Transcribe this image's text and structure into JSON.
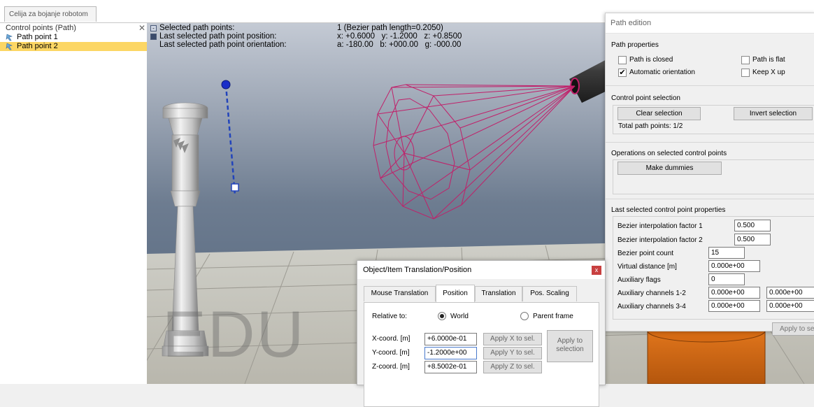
{
  "tab": {
    "label": "Celija za bojanje robotom"
  },
  "hierarchy": {
    "title": "Control points (Path)",
    "close": "✕",
    "items": [
      {
        "label": "Path point 1",
        "selected": false
      },
      {
        "label": "Path point 2",
        "selected": true
      }
    ]
  },
  "info": {
    "minimize_glyph": "-",
    "rows": [
      {
        "label": "Selected path points:",
        "value": "1 (Bezier path length=0.2050)"
      },
      {
        "label": "Last selected path point position:",
        "value": "x: +0.6000   y: -1.2000   z: +0.8500"
      },
      {
        "label": "Last selected path point orientation:",
        "value": "a: -180.00   b: +000.00   g: -000.00"
      }
    ]
  },
  "watermark": "EDU",
  "path_edition": {
    "title": "Path edition",
    "path_properties": "Path properties",
    "path_is_closed": "Path is closed",
    "path_is_flat": "Path is flat",
    "automatic_orientation": "Automatic orientation",
    "keep_x_up": "Keep X up",
    "check_mark": "✔",
    "checks": {
      "path_is_closed": false,
      "path_is_flat": false,
      "automatic_orientation": true,
      "keep_x_up": false
    },
    "control_point_selection": "Control point selection",
    "clear_selection": "Clear selection",
    "invert_selection": "Invert selection",
    "total_path_points": "Total path points: 1/2",
    "operations": "Operations on selected control points",
    "make_dummies": "Make dummies",
    "last_selected_props": "Last selected control point properties",
    "bezier_factor_1_label": "Bezier interpolation factor 1",
    "bezier_factor_1": "0.500",
    "bezier_factor_2_label": "Bezier interpolation factor 2",
    "bezier_factor_2": "0.500",
    "bezier_count_label": "Bezier point count",
    "bezier_count": "15",
    "virtual_distance_label": "Virtual distance [m]",
    "virtual_distance": "0.000e+00",
    "aux_flags_label": "Auxiliary flags",
    "aux_flags": "0",
    "aux_12_label": "Auxiliary channels 1-2",
    "aux_1": "0.000e+00",
    "aux_2": "0.000e+00",
    "aux_34_label": "Auxiliary channels 3-4",
    "aux_3": "0.000e+00",
    "aux_4": "0.000e+00",
    "apply_to_selection": "Apply to se"
  },
  "translation_dialog": {
    "title": "Object/Item Translation/Position",
    "close": "x",
    "tabs": [
      "Mouse Translation",
      "Position",
      "Translation",
      "Pos. Scaling"
    ],
    "active_tab": 1,
    "relative_to": "Relative to:",
    "world": "World",
    "parent_frame": "Parent frame",
    "relative_world": true,
    "x_label": "X-coord. [m]",
    "x_value": "+6.0000e-01",
    "y_label": "Y-coord. [m]",
    "y_value": "-1.2000e+00",
    "z_label": "Z-coord. [m]",
    "z_value": "+8.5002e-01",
    "apply_x": "Apply X to sel.",
    "apply_y": "Apply Y to sel.",
    "apply_z": "Apply Z to sel.",
    "apply_to": "Apply to",
    "selection": "selection"
  },
  "colors": {
    "selection_highlight": "#fcd664",
    "path_line": "#2244bb",
    "wireframe": "#c0206a"
  }
}
